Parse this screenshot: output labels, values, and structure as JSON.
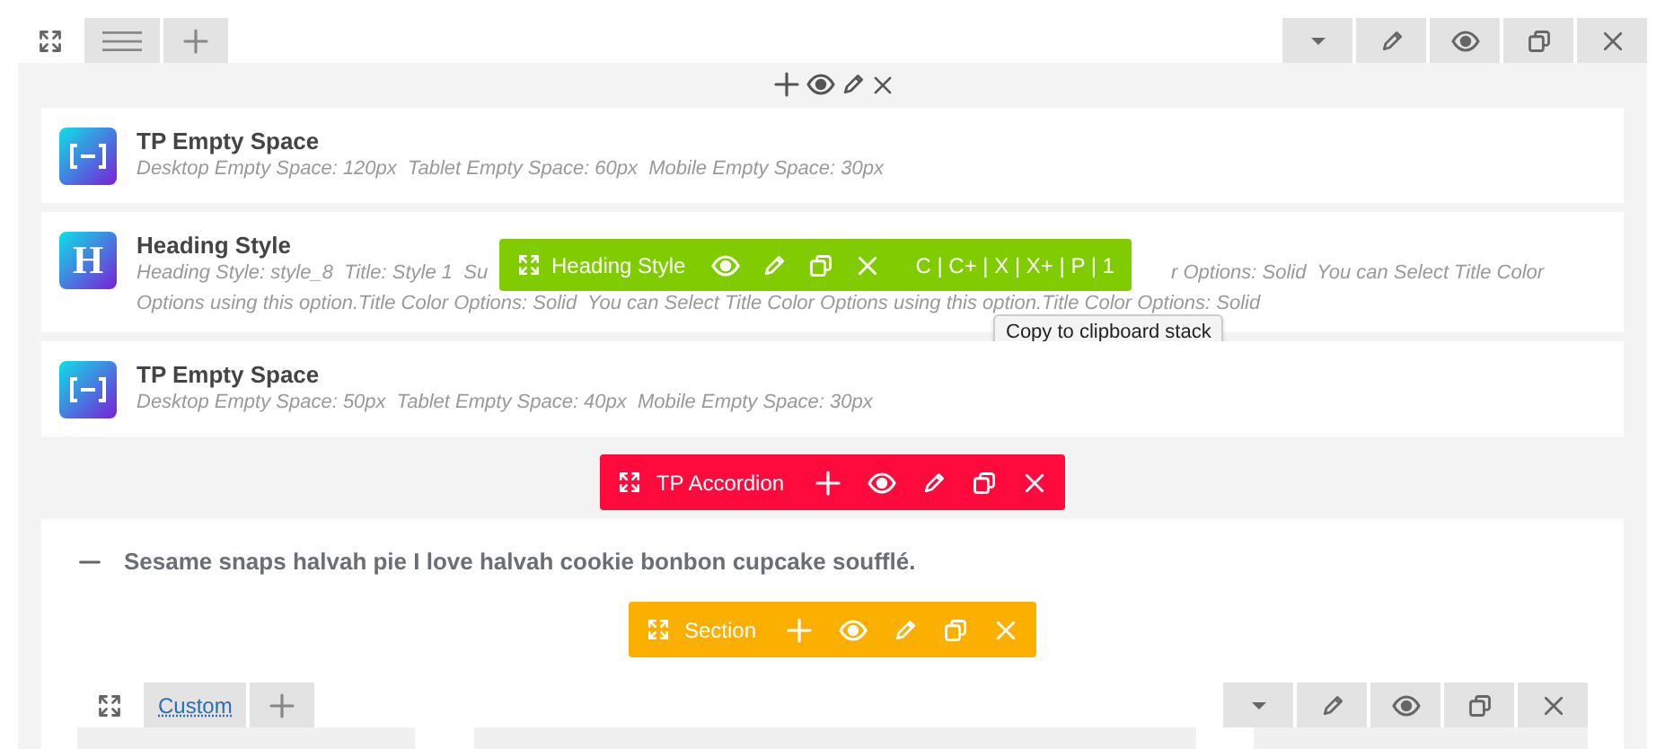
{
  "cards": [
    {
      "kind": "empty-space",
      "title": "TP Empty Space",
      "description": "Desktop Empty Space: 120px  Tablet Empty Space: 60px  Mobile Empty Space: 30px"
    },
    {
      "kind": "heading",
      "icon_letter": "H",
      "title": "Heading Style",
      "description_start": "Heading Style: style_8  Title: Style 1  Su",
      "description_end": "r Options: Solid  You can Select Title Color",
      "description_line_2": "Options using this option.Title Color Options: Solid  You can Select Title Color Options using this option.Title Color Options: Solid"
    },
    {
      "kind": "empty-space",
      "title": "TP Empty Space",
      "description": "Desktop Empty Space: 50px  Tablet Empty Space: 40px  Mobile Empty Space: 30px"
    }
  ],
  "heading_toolbar": {
    "label": "Heading Style",
    "clipboard": "C | C+ | X | X+ | P | 1",
    "tooltip": "Copy to clipboard stack"
  },
  "accordion_toolbar": {
    "label": "TP Accordion"
  },
  "accordion": {
    "title": "Sesame snaps halvah pie I love halvah cookie bonbon cupcake soufflé.",
    "expanded": true
  },
  "section_toolbar": {
    "label": "Section"
  },
  "inner_row": {
    "tab_label": "Custom"
  }
}
